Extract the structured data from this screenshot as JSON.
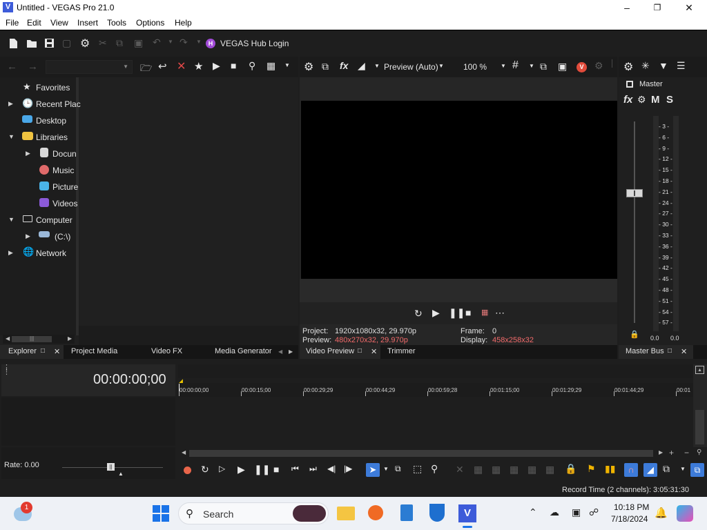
{
  "window": {
    "title": "Untitled - VEGAS Pro 21.0",
    "app_icon_letter": "V"
  },
  "menu": [
    "File",
    "Edit",
    "View",
    "Insert",
    "Tools",
    "Options",
    "Help"
  ],
  "toolbar": {
    "hub_label": "VEGAS Hub Login",
    "hub_icon_letter": "H"
  },
  "explorer": {
    "tree": [
      {
        "label": "Favorites"
      },
      {
        "label": "Recent Plac"
      },
      {
        "label": "Desktop"
      },
      {
        "label": "Libraries"
      },
      {
        "label": "Docun"
      },
      {
        "label": "Music"
      },
      {
        "label": "Picture"
      },
      {
        "label": "Videos"
      },
      {
        "label": "Computer"
      },
      {
        "label": "(C:\\)"
      },
      {
        "label": "Network"
      }
    ]
  },
  "preview": {
    "mode": "Preview (Auto)",
    "zoom": "100 %",
    "project_label": "Project:",
    "project_value": "1920x1080x32, 29.970p",
    "preview_label": "Preview:",
    "preview_value": "480x270x32, 29.970p",
    "frame_label": "Frame:",
    "frame_value": "0",
    "display_label": "Display:",
    "display_value": "458x258x32"
  },
  "mixer": {
    "master_label": "Master",
    "fx_label": "fx",
    "m_label": "M",
    "s_label": "S",
    "scale": [
      "3",
      "6",
      "9",
      "12",
      "15",
      "18",
      "21",
      "24",
      "27",
      "30",
      "33",
      "36",
      "39",
      "42",
      "45",
      "48",
      "51",
      "54",
      "57"
    ],
    "peak_left": "0.0",
    "peak_right": "0.0"
  },
  "tabs": {
    "explorer": "Explorer",
    "project_media": "Project Media",
    "video_fx": "Video FX",
    "media_generators": "Media Generator",
    "video_preview": "Video Preview",
    "trimmer": "Trimmer",
    "master_bus": "Master Bus"
  },
  "timeline": {
    "timecode": "00:00:00;00",
    "ruler": [
      "00:00:00;00",
      "00:00:15;00",
      "00:00:29;29",
      "00:00:44;29",
      "00:00:59;28",
      "00:01:15;00",
      "00:01:29;29",
      "00:01:44;29",
      "00:01"
    ],
    "rate": "Rate: 0.00"
  },
  "status": {
    "record_time": "Record Time (2 channels): 3:05:31:30"
  },
  "taskbar": {
    "search": "Search",
    "time": "10:18 PM",
    "date": "7/18/2024",
    "weather_badge": "1"
  },
  "colors": {
    "accent_blue": "#3d7bd9",
    "warning_red": "#f26b6b",
    "playhead_yellow": "#e8c400"
  }
}
